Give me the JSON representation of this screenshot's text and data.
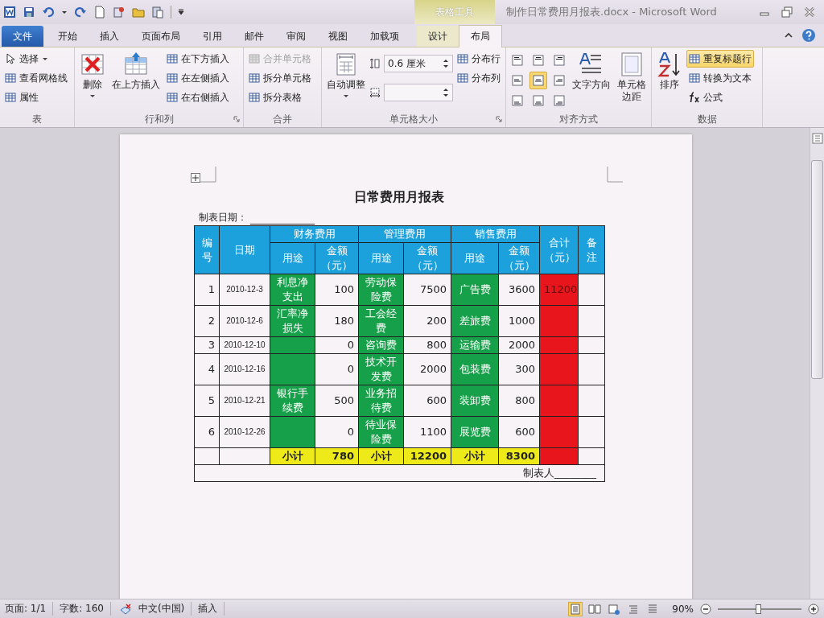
{
  "window": {
    "title": "制作日常费用月报表.docx - Microsoft Word",
    "contextual_group": "表格工具"
  },
  "tabs": [
    {
      "label": "文件",
      "kind": "file",
      "selected": false
    },
    {
      "label": "开始",
      "kind": "normal",
      "selected": false
    },
    {
      "label": "插入",
      "kind": "normal",
      "selected": false
    },
    {
      "label": "页面布局",
      "kind": "normal",
      "selected": false
    },
    {
      "label": "引用",
      "kind": "normal",
      "selected": false
    },
    {
      "label": "邮件",
      "kind": "normal",
      "selected": false
    },
    {
      "label": "审阅",
      "kind": "normal",
      "selected": false
    },
    {
      "label": "视图",
      "kind": "normal",
      "selected": false
    },
    {
      "label": "加载项",
      "kind": "normal",
      "selected": false
    },
    {
      "label": "设计",
      "kind": "contextual",
      "selected": false
    },
    {
      "label": "布局",
      "kind": "contextual",
      "selected": true
    }
  ],
  "ribbon": [
    {
      "name": "表",
      "launcher": false,
      "columns": [
        [
          {
            "kind": "small",
            "label": "选择",
            "dropdown": true,
            "disabled": false
          },
          {
            "kind": "small",
            "label": "查看网格线",
            "dropdown": false,
            "disabled": false
          },
          {
            "kind": "small",
            "label": "属性",
            "dropdown": false,
            "disabled": false
          }
        ]
      ]
    },
    {
      "name": "行和列",
      "launcher": true,
      "columns": [
        [
          {
            "kind": "large",
            "lines": [
              "删除"
            ],
            "dropdown": true,
            "disabled": false
          }
        ],
        [
          {
            "kind": "large",
            "lines": [
              "在上方插入"
            ],
            "dropdown": false,
            "disabled": false
          }
        ],
        [
          {
            "kind": "small",
            "label": "在下方插入",
            "dropdown": false,
            "disabled": false
          },
          {
            "kind": "small",
            "label": "在左侧插入",
            "dropdown": false,
            "disabled": false
          },
          {
            "kind": "small",
            "label": "在右侧插入",
            "dropdown": false,
            "disabled": false
          }
        ]
      ]
    },
    {
      "name": "合并",
      "launcher": false,
      "columns": [
        [
          {
            "kind": "small",
            "label": "合并单元格",
            "dropdown": false,
            "disabled": true
          },
          {
            "kind": "small",
            "label": "拆分单元格",
            "dropdown": false,
            "disabled": false
          },
          {
            "kind": "small",
            "label": "拆分表格",
            "dropdown": false,
            "disabled": false
          }
        ]
      ]
    },
    {
      "name": "单元格大小",
      "launcher": true,
      "columns": [
        [
          {
            "kind": "large",
            "lines": [
              "自动调整"
            ],
            "dropdown": true,
            "disabled": false
          }
        ],
        [
          {
            "kind": "spin",
            "value": "0.6 厘米"
          },
          {
            "kind": "spin"
          }
        ],
        [
          {
            "kind": "small",
            "label": "分布行",
            "dropdown": false,
            "disabled": false
          },
          {
            "kind": "small",
            "label": "分布列",
            "dropdown": false,
            "disabled": false
          }
        ]
      ]
    },
    {
      "name": "对齐方式",
      "launcher": false,
      "columns": [
        [
          {
            "kind": "align",
            "cells": [
              {
                "selected": false
              },
              {
                "selected": false
              },
              {
                "selected": false
              },
              {
                "selected": false
              },
              {
                "selected": true
              },
              {
                "selected": false
              },
              {
                "selected": false
              },
              {
                "selected": false
              },
              {
                "selected": false
              }
            ]
          }
        ],
        [
          {
            "kind": "large",
            "lines": [
              "文字方向"
            ],
            "dropdown": false,
            "disabled": false
          }
        ],
        [
          {
            "kind": "large",
            "lines": [
              "单元格",
              "边距"
            ],
            "dropdown": false,
            "disabled": false
          }
        ]
      ]
    },
    {
      "name": "数据",
      "launcher": false,
      "columns": [
        [
          {
            "kind": "large",
            "lines": [
              "排序"
            ],
            "dropdown": false,
            "disabled": false
          }
        ],
        [
          {
            "kind": "small",
            "label": "重复标题行",
            "dropdown": false,
            "disabled": false,
            "selected": true
          },
          {
            "kind": "small",
            "label": "转换为文本",
            "dropdown": false,
            "disabled": false,
            "selected": false
          },
          {
            "kind": "small",
            "label": "公式",
            "dropdown": false,
            "disabled": false,
            "selected": false
          }
        ]
      ]
    }
  ],
  "document": {
    "title": "日常费用月报表",
    "date_label": "制表日期：",
    "table": {
      "header_top": [
        {
          "text": "编号",
          "kind": "single"
        },
        {
          "text": "日期",
          "kind": "single"
        },
        {
          "text": "财务费用",
          "kind": "group"
        },
        {
          "text": "管理费用",
          "kind": "group"
        },
        {
          "text": "销售费用",
          "kind": "group"
        },
        {
          "text": "合计（元）",
          "kind": "single"
        },
        {
          "text": "备注",
          "kind": "single"
        }
      ],
      "header_sub": [
        "用途",
        "金额（元）",
        "用途",
        "金额（元）",
        "用途",
        "金额（元）"
      ],
      "rows": [
        {
          "cells": [
            {
              "text": "1"
            },
            {
              "text": "2010-12-3"
            },
            {
              "text": "利息净支出",
              "color": "#17a04a"
            },
            {
              "text": "100"
            },
            {
              "text": "劳动保险费",
              "color": "#17a04a"
            },
            {
              "text": "7500"
            },
            {
              "text": "广告费",
              "color": "#17a04a"
            },
            {
              "text": "3600"
            },
            {
              "text": "11200",
              "color": "#e8161c"
            },
            {}
          ]
        },
        {
          "cells": [
            {
              "text": "2"
            },
            {
              "text": "2010-12-6"
            },
            {
              "text": "汇率净损失",
              "color": "#17a04a"
            },
            {
              "text": "180"
            },
            {
              "text": "工会经费",
              "color": "#17a04a"
            },
            {
              "text": "200"
            },
            {
              "text": "差旅费",
              "color": "#17a04a"
            },
            {
              "text": "1000"
            },
            {
              "color": "#e8161c"
            },
            {}
          ]
        },
        {
          "cells": [
            {
              "text": "3"
            },
            {
              "text": "2010-12-10"
            },
            {
              "color": "#17a04a"
            },
            {
              "text": "0"
            },
            {
              "text": "咨询费",
              "color": "#17a04a"
            },
            {
              "text": "800"
            },
            {
              "text": "运输费",
              "color": "#17a04a"
            },
            {
              "text": "2000"
            },
            {
              "color": "#e8161c"
            },
            {}
          ]
        },
        {
          "cells": [
            {
              "text": "4"
            },
            {
              "text": "2010-12-16"
            },
            {
              "color": "#17a04a"
            },
            {
              "text": "0"
            },
            {
              "text": "技术开发费",
              "color": "#17a04a"
            },
            {
              "text": "2000"
            },
            {
              "text": "包装费",
              "color": "#17a04a"
            },
            {
              "text": "300"
            },
            {
              "color": "#e8161c"
            },
            {}
          ]
        },
        {
          "cells": [
            {
              "text": "5"
            },
            {
              "text": "2010-12-21"
            },
            {
              "text": "银行手续费",
              "color": "#17a04a"
            },
            {
              "text": "500"
            },
            {
              "text": "业务招待费",
              "color": "#17a04a"
            },
            {
              "text": "600"
            },
            {
              "text": "装卸费",
              "color": "#17a04a"
            },
            {
              "text": "800"
            },
            {
              "color": "#e8161c"
            },
            {}
          ]
        },
        {
          "cells": [
            {
              "text": "6"
            },
            {
              "text": "2010-12-26"
            },
            {
              "color": "#17a04a"
            },
            {
              "text": "0"
            },
            {
              "text": "待业保险费",
              "color": "#17a04a"
            },
            {
              "text": "1100"
            },
            {
              "text": "展览费",
              "color": "#17a04a"
            },
            {
              "text": "600"
            },
            {
              "color": "#e8161c"
            },
            {}
          ]
        },
        {
          "kind": "subtotal",
          "cells": [
            {},
            {},
            {
              "text": "小计",
              "color": "#eeea1a"
            },
            {
              "text": "780",
              "color": "#eeea1a"
            },
            {
              "text": "小计",
              "color": "#eeea1a"
            },
            {
              "text": "12200",
              "color": "#eeea1a"
            },
            {
              "text": "小计",
              "color": "#eeea1a"
            },
            {
              "text": "8300",
              "color": "#eeea1a"
            },
            {
              "color": "#e8161c"
            },
            {}
          ]
        }
      ],
      "footer": "制表人________"
    }
  },
  "status_bar": {
    "page": "页面: 1/1",
    "words": "字数: 160",
    "language": "中文(中国)",
    "mode": "插入",
    "zoom": "90%",
    "zoom_slider": {
      "level": 0.48
    }
  }
}
